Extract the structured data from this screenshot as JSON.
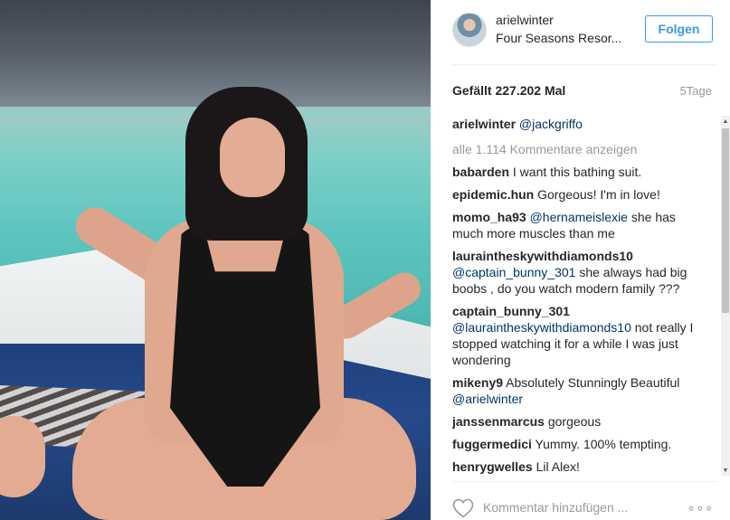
{
  "post": {
    "image_alt": "Photo",
    "username": "arielwinter",
    "location": "Four Seasons Resor...",
    "follow_label": "Folgen",
    "likes_text": "Gefällt 227.202 Mal",
    "age_text": "5Tage"
  },
  "caption": {
    "user": "arielwinter",
    "glyph_before": "",
    "mention": "@jackgriffo",
    "glyph_after": ""
  },
  "view_all_text": "alle 1.114 Kommentare anzeigen",
  "comments": [
    {
      "user": "babarden",
      "mention": "",
      "text": "I want this bathing suit."
    },
    {
      "user": "epidemic.hun",
      "mention": "",
      "text": "Gorgeous! I'm in love!"
    },
    {
      "user": "momo_ha93",
      "mention": "@hernameislexie",
      "text": "she has much more muscles than me"
    },
    {
      "user": "lauraintheskywithdiamonds10",
      "mention": "@captain_bunny_301",
      "text": "she always had big boobs , do you watch modern family ???"
    },
    {
      "user": "captain_bunny_301",
      "mention": "@lauraintheskywithdiamonds10",
      "text": "not really I stopped watching it for a while I was just wondering"
    },
    {
      "user": "mikeny9",
      "mention": "",
      "text": "Absolutely Stunningly Beautiful",
      "mention_after": "@arielwinter"
    },
    {
      "user": "janssenmarcus",
      "mention": "",
      "text": "gorgeous"
    },
    {
      "user": "fuggermedici",
      "mention": "",
      "text": "Yummy. 100% tempting."
    },
    {
      "user": "henrygwelles",
      "mention": "",
      "text": "Lil Alex!"
    }
  ],
  "footer": {
    "comment_placeholder": "Kommentar hinzufügen ...",
    "more_label": "∘∘∘"
  },
  "icons": {
    "heart": "heart-icon",
    "more": "more-options-icon",
    "scroll_up": "scroll-up-arrow-icon",
    "scroll_down": "scroll-down-arrow-icon"
  },
  "colors": {
    "accent": "#3897f0",
    "mention": "#003569",
    "muted": "#999999",
    "text": "#262626"
  }
}
